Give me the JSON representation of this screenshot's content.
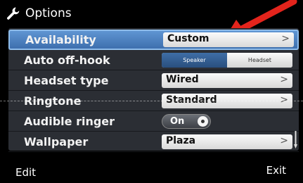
{
  "header": {
    "title": "Options",
    "icon": "wrench-icon"
  },
  "annotation": {
    "arrow_color": "#e3241c"
  },
  "settings": [
    {
      "label": "Availability",
      "value": "Custom"
    },
    {
      "label": "Auto off-hook",
      "options": [
        "Speaker",
        "Headset"
      ],
      "selected": "Speaker"
    },
    {
      "label": "Headset type",
      "value": "Wired"
    },
    {
      "label": "Ringtone",
      "value": "Standard"
    },
    {
      "label": "Audible ringer",
      "value": "On"
    },
    {
      "label": "Wallpaper",
      "value": "Plaza"
    }
  ],
  "softkeys": {
    "left": "Edit",
    "right": "Exit"
  },
  "colors": {
    "selection": "#4a7fc1",
    "panel": "#2b2e34"
  }
}
